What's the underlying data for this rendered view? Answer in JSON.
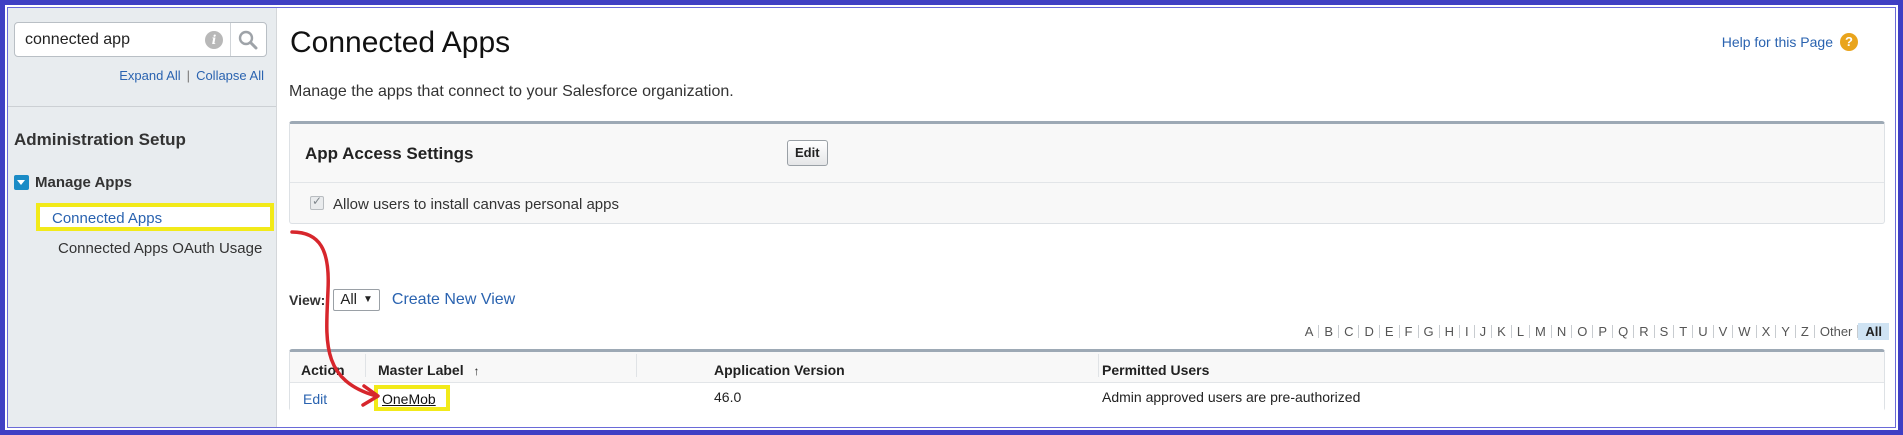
{
  "sidebar": {
    "search": {
      "value": "connected app",
      "placeholder": ""
    },
    "expand_all": "Expand All",
    "separator": "|",
    "collapse_all": "Collapse All",
    "section_title": "Administration Setup",
    "group_label": "Manage Apps",
    "items": [
      {
        "label": "Connected Apps"
      },
      {
        "label": "Connected Apps OAuth Usage"
      }
    ]
  },
  "main": {
    "title": "Connected Apps",
    "help_link": "Help for this Page",
    "description": "Manage the apps that connect to your Salesforce organization.",
    "access_settings": {
      "title": "App Access Settings",
      "edit_label": "Edit",
      "checkbox_label": "Allow users to install canvas personal apps",
      "checkbox_checked": true
    },
    "view": {
      "label": "View:",
      "selected": "All",
      "create_new": "Create New View"
    },
    "alphabet": [
      "A",
      "B",
      "C",
      "D",
      "E",
      "F",
      "G",
      "H",
      "I",
      "J",
      "K",
      "L",
      "M",
      "N",
      "O",
      "P",
      "Q",
      "R",
      "S",
      "T",
      "U",
      "V",
      "W",
      "X",
      "Y",
      "Z",
      "Other",
      "All"
    ],
    "table": {
      "headers": [
        "Action",
        "Master Label",
        "Application Version",
        "Permitted Users"
      ],
      "sort_indicator": "↑",
      "rows": [
        {
          "action": "Edit",
          "label": "OneMob",
          "version": "46.0",
          "permitted": "Admin approved users are pre-authorized"
        }
      ]
    }
  },
  "colors": {
    "highlight": "#f2ea19",
    "arrow": "#d7262c",
    "link": "#2a63b0",
    "frame": "#3f3fc4"
  }
}
